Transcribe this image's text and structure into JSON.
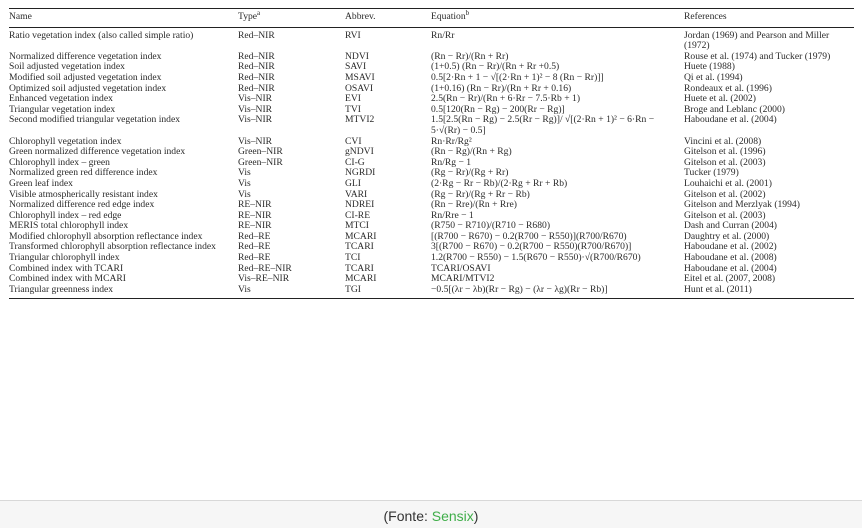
{
  "table": {
    "headers": {
      "name": "Name",
      "type": "Type",
      "type_note": "a",
      "abbrev": "Abbrev.",
      "equation": "Equation",
      "equation_note": "b",
      "references": "References"
    },
    "rows": [
      {
        "name": "Ratio vegetation index (also called simple ratio)",
        "type": "Red–NIR",
        "abbrev": "RVI",
        "equation": "Rn/Rr",
        "references": "Jordan (1969) and Pearson and Miller (1972)"
      },
      {
        "name": "Normalized difference vegetation index",
        "type": "Red–NIR",
        "abbrev": "NDVI",
        "equation": "(Rn − Rr)/(Rn + Rr)",
        "references": "Rouse et al. (1974) and Tucker (1979)"
      },
      {
        "name": "Soil adjusted vegetation index",
        "type": "Red–NIR",
        "abbrev": "SAVI",
        "equation": "(1+0.5) (Rn − Rr)/(Rn + Rr +0.5)",
        "references": "Huete (1988)"
      },
      {
        "name": "Modified soil adjusted vegetation index",
        "type": "Red–NIR",
        "abbrev": "MSAVI",
        "equation": "0.5[2·Rn + 1 − √[(2·Rn + 1)² − 8 (Rn − Rr)]]",
        "references": "Qi et al. (1994)"
      },
      {
        "name": "Optimized soil adjusted vegetation index",
        "type": "Red–NIR",
        "abbrev": "OSAVI",
        "equation": "(1+0.16) (Rn − Rr)/(Rn + Rr + 0.16)",
        "references": "Rondeaux et al. (1996)"
      },
      {
        "name": "Enhanced vegetation index",
        "type": "Vis–NIR",
        "abbrev": "EVI",
        "equation": "2.5(Rn − Rr)/(Rn + 6·Rr − 7.5·Rb + 1)",
        "references": "Huete et al. (2002)"
      },
      {
        "name": "Triangular vegetation index",
        "type": "Vis–NIR",
        "abbrev": "TVI",
        "equation": "0.5[120(Rn − Rg) − 200(Rr − Rg)]",
        "references": "Broge and Leblanc (2000)"
      },
      {
        "name": "Second modified triangular vegetation index",
        "type": "Vis–NIR",
        "abbrev": "MTVI2",
        "equation": "1.5[2.5(Rn − Rg) − 2.5(Rr − Rg)]/ √[(2·Rn + 1)² − 6·Rn − 5·√(Rr) − 0.5]",
        "references": "Haboudane et al. (2004)"
      },
      {
        "name": "Chlorophyll vegetation index",
        "type": "Vis–NIR",
        "abbrev": "CVI",
        "equation": "Rn·Rr/Rg²",
        "references": "Vincini et al. (2008)"
      },
      {
        "name": "Green normalized difference vegetation index",
        "type": "Green–NIR",
        "abbrev": "gNDVI",
        "equation": "(Rn − Rg)/(Rn + Rg)",
        "references": "Gitelson et al. (1996)"
      },
      {
        "name": "Chlorophyll index – green",
        "type": "Green–NIR",
        "abbrev": "CI-G",
        "equation": "Rn/Rg − 1",
        "references": "Gitelson et al. (2003)"
      },
      {
        "name": "Normalized green red difference index",
        "type": "Vis",
        "abbrev": "NGRDI",
        "equation": "(Rg − Rr)/(Rg + Rr)",
        "references": "Tucker (1979)"
      },
      {
        "name": "Green leaf index",
        "type": "Vis",
        "abbrev": "GLI",
        "equation": "(2·Rg − Rr − Rb)/(2·Rg + Rr + Rb)",
        "references": "Louhaichi et al. (2001)"
      },
      {
        "name": "Visible atmospherically resistant index",
        "type": "Vis",
        "abbrev": "VARI",
        "equation": "(Rg − Rr)/(Rg + Rr − Rb)",
        "references": "Gitelson et al. (2002)"
      },
      {
        "name": "Normalized difference red edge index",
        "type": "RE–NIR",
        "abbrev": "NDREI",
        "equation": "(Rn − Rre)/(Rn + Rre)",
        "references": "Gitelson and Merzlyak (1994)"
      },
      {
        "name": "Chlorophyll index – red edge",
        "type": "RE–NIR",
        "abbrev": "CI-RE",
        "equation": "Rn/Rre − 1",
        "references": "Gitelson et al. (2003)"
      },
      {
        "name": "MERIS total chlorophyll index",
        "type": "RE–NIR",
        "abbrev": "MTCI",
        "equation": "(R750 − R710)/(R710 − R680)",
        "references": "Dash and Curran (2004)"
      },
      {
        "name": "Modified chlorophyll absorption reflectance index",
        "type": "Red–RE",
        "abbrev": "MCARI",
        "equation": "[(R700 − R670) − 0.2(R700 − R550)](R700/R670)",
        "references": "Daughtry et al. (2000)"
      },
      {
        "name": "Transformed chlorophyll absorption reflectance index",
        "type": "Red–RE",
        "abbrev": "TCARI",
        "equation": "3[(R700 − R670) − 0.2(R700 − R550)(R700/R670)]",
        "references": "Haboudane et al. (2002)"
      },
      {
        "name": "Triangular chlorophyll index",
        "type": "Red–RE",
        "abbrev": "TCI",
        "equation": "1.2(R700 − R550) − 1.5(R670 − R550)·√(R700/R670)",
        "references": "Haboudane et al. (2008)"
      },
      {
        "name": "Combined index with TCARI",
        "type": "Red–RE–NIR",
        "abbrev": "TCARI",
        "equation": "TCARI/OSAVI",
        "references": "Haboudane et al. (2004)"
      },
      {
        "name": "Combined index with MCARI",
        "type": "Vis–RE–NIR",
        "abbrev": "MCARI",
        "equation": "MCARI/MTVI2",
        "references": "Eitel et al. (2007, 2008)"
      },
      {
        "name": "Triangular greenness index",
        "type": "Vis",
        "abbrev": "TGI",
        "equation": "−0.5[(λr − λb)(Rr − Rg) − (λr − λg)(Rr − Rb)]",
        "references": "Hunt et al. (2011)"
      }
    ]
  },
  "caption": {
    "prefix": "(Fonte: ",
    "source": "Sensix",
    "suffix": ")"
  },
  "colors": {
    "source_link": "#3fae49",
    "text": "#2a2a2a",
    "page_background": "#f6f6f6"
  }
}
